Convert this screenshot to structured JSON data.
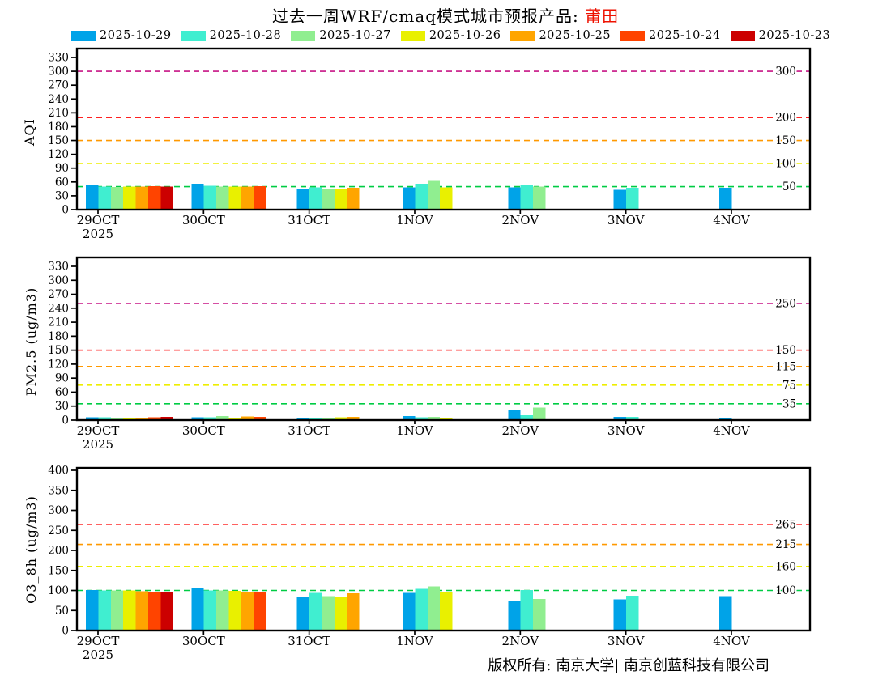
{
  "title": {
    "prefix": "过去一周WRF/cmaq模式城市预报产品: ",
    "city": "莆田",
    "city_color": "#ee1100"
  },
  "legend": {
    "items": [
      {
        "label": "2025-10-29",
        "color": "#00a3e8"
      },
      {
        "label": "2025-10-28",
        "color": "#40eed0"
      },
      {
        "label": "2025-10-27",
        "color": "#90ee90"
      },
      {
        "label": "2025-10-26",
        "color": "#e9f000"
      },
      {
        "label": "2025-10-25",
        "color": "#ffa500"
      },
      {
        "label": "2025-10-24",
        "color": "#ff4400"
      },
      {
        "label": "2025-10-23",
        "color": "#cc0000"
      }
    ]
  },
  "footer": {
    "copyright": "版权所有: 南京大学| 南京创蓝科技有限公司"
  },
  "chart_data": [
    {
      "type": "bar",
      "ylabel": "AQI",
      "ylim": [
        0,
        330
      ],
      "ytick_interval": 30,
      "categories": [
        "29OCT",
        "30OCT",
        "31OCT",
        "1NOV",
        "2NOV",
        "3NOV",
        "4NOV"
      ],
      "year_label": "2025",
      "legend_position": "top",
      "grid": false,
      "series": [
        {
          "name": "2025-10-29",
          "color": "#00a3e8",
          "values": [
            54,
            56,
            45,
            48,
            48,
            43,
            47
          ]
        },
        {
          "name": "2025-10-28",
          "color": "#40eed0",
          "values": [
            50,
            52,
            48,
            56,
            53,
            47,
            null
          ]
        },
        {
          "name": "2025-10-27",
          "color": "#90ee90",
          "values": [
            49,
            50,
            44,
            62,
            50,
            null,
            null
          ]
        },
        {
          "name": "2025-10-26",
          "color": "#e9f000",
          "values": [
            50,
            50,
            44,
            48,
            null,
            null,
            null
          ]
        },
        {
          "name": "2025-10-25",
          "color": "#ffa500",
          "values": [
            50,
            50,
            47,
            null,
            null,
            null,
            null
          ]
        },
        {
          "name": "2025-10-24",
          "color": "#ff4400",
          "values": [
            51,
            51,
            null,
            null,
            null,
            null,
            null
          ]
        },
        {
          "name": "2025-10-23",
          "color": "#cc0000",
          "values": [
            50,
            null,
            null,
            null,
            null,
            null,
            null
          ]
        }
      ],
      "ref_lines": [
        {
          "value": 50,
          "color": "#00cc44",
          "label": "50"
        },
        {
          "value": 100,
          "color": "#eeee00",
          "label": "100"
        },
        {
          "value": 150,
          "color": "#ff9900",
          "label": "150"
        },
        {
          "value": 200,
          "color": "#ff0000",
          "label": "200"
        },
        {
          "value": 300,
          "color": "#c71585",
          "label": "300"
        }
      ]
    },
    {
      "type": "bar",
      "ylabel": "PM2.5 (ug/m3)",
      "ylim": [
        0,
        330
      ],
      "ytick_interval": 30,
      "categories": [
        "29OCT",
        "30OCT",
        "31OCT",
        "1NOV",
        "2NOV",
        "3NOV",
        "4NOV"
      ],
      "year_label": "2025",
      "legend_position": "top",
      "grid": false,
      "series": [
        {
          "name": "2025-10-29",
          "color": "#00a3e8",
          "values": [
            6,
            6,
            5,
            9,
            22,
            7,
            5
          ]
        },
        {
          "name": "2025-10-28",
          "color": "#40eed0",
          "values": [
            6,
            6,
            5,
            6,
            10,
            7,
            null
          ]
        },
        {
          "name": "2025-10-27",
          "color": "#90ee90",
          "values": [
            4,
            9,
            4,
            7,
            27,
            null,
            null
          ]
        },
        {
          "name": "2025-10-26",
          "color": "#e9f000",
          "values": [
            5,
            5,
            6,
            4,
            null,
            null,
            null
          ]
        },
        {
          "name": "2025-10-25",
          "color": "#ffa500",
          "values": [
            5,
            8,
            7,
            null,
            null,
            null,
            null
          ]
        },
        {
          "name": "2025-10-24",
          "color": "#ff4400",
          "values": [
            6,
            7,
            null,
            null,
            null,
            null,
            null
          ]
        },
        {
          "name": "2025-10-23",
          "color": "#cc0000",
          "values": [
            7,
            null,
            null,
            null,
            null,
            null,
            null
          ]
        }
      ],
      "ref_lines": [
        {
          "value": 35,
          "color": "#00cc44",
          "label": "35"
        },
        {
          "value": 75,
          "color": "#eeee00",
          "label": "75"
        },
        {
          "value": 115,
          "color": "#ff9900",
          "label": "115"
        },
        {
          "value": 150,
          "color": "#ff0000",
          "label": "150"
        },
        {
          "value": 250,
          "color": "#c71585",
          "label": "250"
        }
      ]
    },
    {
      "type": "bar",
      "ylabel": "O3_8h (ug/m3)",
      "ylim": [
        0,
        400
      ],
      "ytick_interval": 50,
      "categories": [
        "29OCT",
        "30OCT",
        "31OCT",
        "1NOV",
        "2NOV",
        "3NOV",
        "4NOV"
      ],
      "year_label": "2025",
      "legend_position": "top",
      "grid": false,
      "series": [
        {
          "name": "2025-10-29",
          "color": "#00a3e8",
          "values": [
            101,
            105,
            85,
            94,
            75,
            78,
            86
          ]
        },
        {
          "name": "2025-10-28",
          "color": "#40eed0",
          "values": [
            100,
            100,
            94,
            104,
            101,
            87,
            null
          ]
        },
        {
          "name": "2025-10-27",
          "color": "#90ee90",
          "values": [
            100,
            100,
            86,
            110,
            79,
            null,
            null
          ]
        },
        {
          "name": "2025-10-26",
          "color": "#e9f000",
          "values": [
            100,
            99,
            85,
            95,
            null,
            null,
            null
          ]
        },
        {
          "name": "2025-10-25",
          "color": "#ffa500",
          "values": [
            98,
            97,
            93,
            null,
            null,
            null,
            null
          ]
        },
        {
          "name": "2025-10-24",
          "color": "#ff4400",
          "values": [
            96,
            96,
            null,
            null,
            null,
            null,
            null
          ]
        },
        {
          "name": "2025-10-23",
          "color": "#cc0000",
          "values": [
            96,
            null,
            null,
            null,
            null,
            null,
            null
          ]
        }
      ],
      "ref_lines": [
        {
          "value": 100,
          "color": "#00cc44",
          "label": "100"
        },
        {
          "value": 160,
          "color": "#eeee00",
          "label": "160"
        },
        {
          "value": 215,
          "color": "#ff9900",
          "label": "215"
        },
        {
          "value": 265,
          "color": "#ff0000",
          "label": "265"
        }
      ]
    }
  ]
}
